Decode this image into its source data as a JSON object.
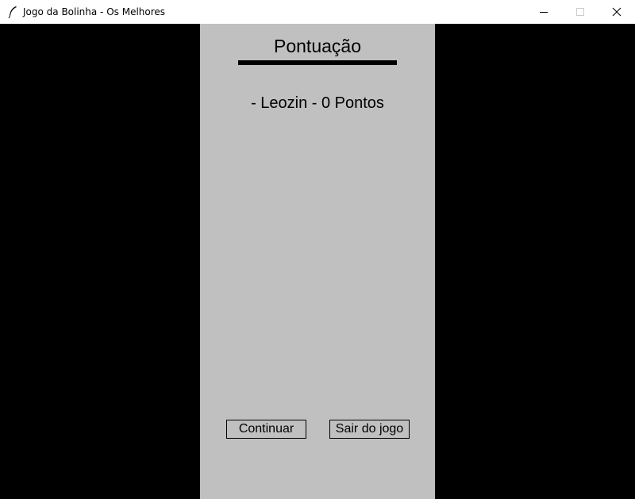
{
  "window": {
    "title": "Jogo da Bolinha - Os Melhores",
    "icon": "feather-icon",
    "controls": [
      "minimize-icon",
      "maximize-icon",
      "close-icon"
    ]
  },
  "scoreboard": {
    "title": "Pontuação",
    "entries": [
      {
        "text": "- Leozin - 0 Pontos"
      }
    ]
  },
  "buttons": {
    "continue_label": "Continuar",
    "quit_label": "Sair do jogo"
  },
  "colors": {
    "background": "#000000",
    "panel": "#c0c0c0",
    "text": "#000000"
  }
}
